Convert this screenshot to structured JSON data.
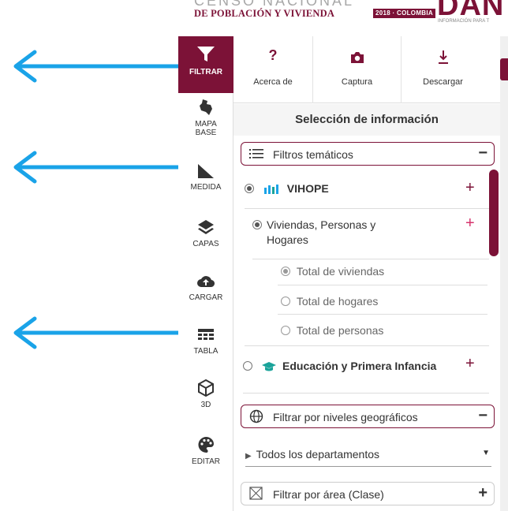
{
  "banner": {
    "title_top": "CENSO NACIONAL",
    "title_bottom": "DE POBLACIÓN Y VIVIENDA",
    "badge": "2018 · COLOMBIA",
    "logo_text": "DAN",
    "logo_sub": "INFORMACIÓN PARA T"
  },
  "toolbar": {
    "filtrar": "FILTRAR",
    "mapa_base": "MAPA BASE",
    "medida": "MEDIDA",
    "capas": "CAPAS",
    "cargar": "CARGAR",
    "tabla": "TABLA",
    "tres_d": "3D",
    "editar": "EDITAR"
  },
  "topbar": {
    "about": "Acerca de",
    "capture": "Captura",
    "download": "Descargar",
    "about_icon": "?"
  },
  "panel": {
    "title": "Selección de información",
    "thematic_filters": "Filtros temáticos",
    "vihope": "VIHOPE",
    "viviendas": "Viviendas, Personas y Hogares",
    "total_viviendas": "Total de viviendas",
    "total_hogares": "Total de hogares",
    "total_personas": "Total de personas",
    "educacion": "Educación y Primera Infancia",
    "geo_filters": "Filtrar por niveles geográficos",
    "departamentos": "Todos los departamentos",
    "area_filter": "Filtrar por área (Clase)"
  },
  "colors": {
    "accent": "#7c1237",
    "arrow": "#1aa3e8",
    "teal": "#1aa39a"
  }
}
